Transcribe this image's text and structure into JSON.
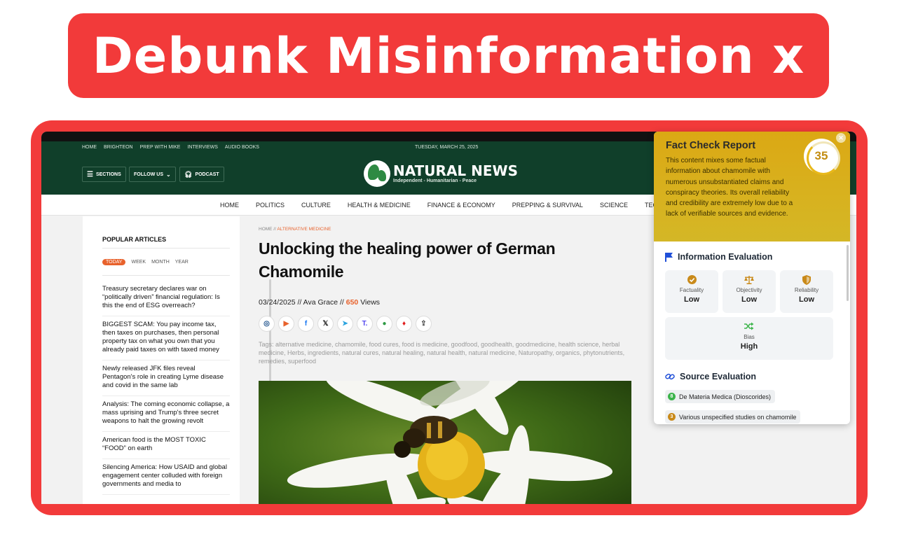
{
  "banner": {
    "title": "Debunk Misinformation x"
  },
  "site": {
    "util_links": [
      "HOME",
      "BRIGHTEON",
      "PREP WITH MIKE",
      "INTERVIEWS",
      "AUDIO BOOKS"
    ],
    "date": "TUESDAY, MARCH 25, 2025",
    "sections_label": "SECTIONS",
    "follow_label": "FOLLOW US",
    "podcast_label": "PODCAST",
    "logo_name": "NATURAL NEWS",
    "logo_tagline": "Independent - Humanitarian - Peace",
    "nav": [
      "HOME",
      "POLITICS",
      "CULTURE",
      "HEALTH & MEDICINE",
      "FINANCE & ECONOMY",
      "PREPPING & SURVIVAL",
      "SCIENCE",
      "TECHNOL"
    ]
  },
  "sidebar": {
    "heading": "POPULAR ARTICLES",
    "tabs": [
      "TODAY",
      "WEEK",
      "MONTH",
      "YEAR"
    ],
    "articles": [
      "Treasury secretary declares war on “politically driven” financial regulation: Is this the end of ESG overreach?",
      "BIGGEST SCAM: You pay income tax, then taxes on purchases, then personal property tax on what you own that you already paid taxes on with taxed money",
      "Newly released JFK files reveal Pentagon's role in creating Lyme disease and covid in the same lab",
      "Analysis: The coming economic collapse, a mass uprising and Trump's three secret weapons to halt the growing revolt",
      "American food is the MOST TOXIC “FOOD” on earth",
      "Silencing America: How USAID and global engagement center colluded with foreign governments and media to"
    ]
  },
  "article": {
    "crumb_home": "HOME",
    "crumb_sep": " // ",
    "crumb_section": "ALTERNATIVE MEDICINE",
    "headline": "Unlocking the healing power of German Chamomile",
    "date": "03/24/2025",
    "by_sep": " // ",
    "author": "Ava Grace",
    "views_count": "650",
    "views_label": "Views",
    "tags": "Tags: alternative medicine, chamomile, food cures, food is medicine, goodfood, goodhealth, goodmedicine, health science, herbal medicine, Herbs, ingredients, natural cures, natural healing, natural health, natural medicine, Naturopathy, organics, phytonutrients, remedies, superfood"
  },
  "panel": {
    "title": "Fact Check Report",
    "score": "35",
    "close": "✕",
    "description": "This content mixes some factual information about chamomile with numerous unsubstantiated claims and conspiracy theories. Its overall reliability and credibility are extremely low due to a lack of verifiable sources and evidence.",
    "info_title": "Information Evaluation",
    "metrics": [
      {
        "label": "Factuality",
        "value": "Low"
      },
      {
        "label": "Objectivity",
        "value": "Low"
      },
      {
        "label": "Reliability",
        "value": "Low"
      },
      {
        "label": "Bias",
        "value": "High"
      }
    ],
    "source_title": "Source Evaluation",
    "sources": [
      {
        "score": "8",
        "name": "De Materia Medica (Dioscorides)",
        "color": "#3cb44b"
      },
      {
        "score": "3",
        "name": "Various unspecified studies on chamomile",
        "color": "#c98a1a"
      }
    ]
  },
  "colors": {
    "banner": "#f23a3a",
    "site_green": "#103f2a",
    "accent_orange": "#e8622c",
    "panel_gold": "#d8b11e"
  }
}
